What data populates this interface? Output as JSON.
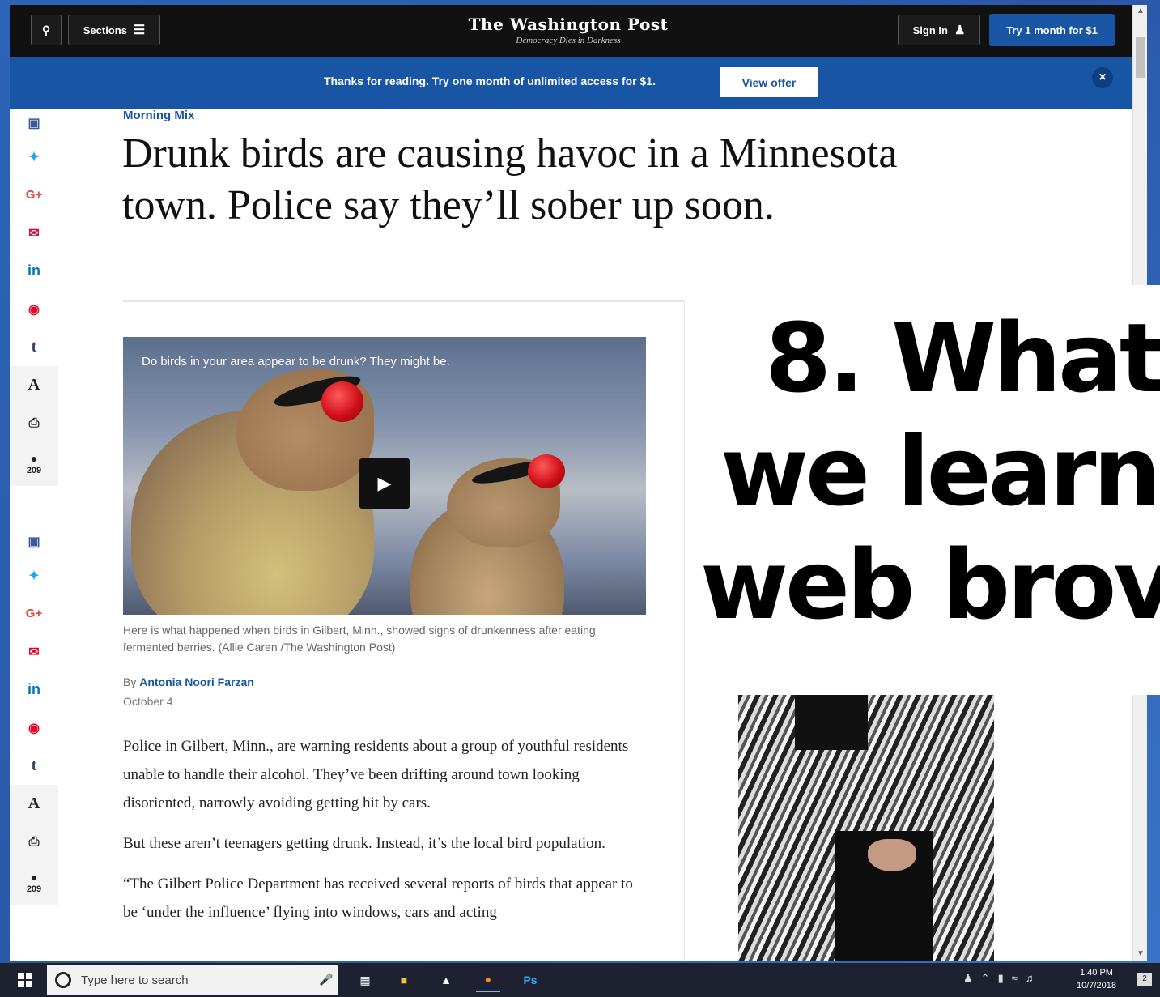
{
  "nav": {
    "sections_label": "Sections",
    "logo": "The Washington Post",
    "tagline": "Democracy Dies in Darkness",
    "signin_label": "Sign In",
    "try_label": "Try 1 month for $1"
  },
  "banner": {
    "text": "Thanks for reading. Try one month of unlimited access for $1.",
    "button": "View offer",
    "close": "×"
  },
  "share_rail": {
    "tools": {
      "font_label": "A",
      "comment_count": "209"
    }
  },
  "article": {
    "kicker": "Morning Mix",
    "headline": "Drunk birds are causing havoc in a Minnesota town. Police say they’ll sober up soon.",
    "video_title": "Do birds in your area appear to be drunk? They might be.",
    "video_caption": "Here is what happened when birds in Gilbert, Minn., showed signs of drunkenness after eating fermented berries. (Allie Caren /The Washington Post)",
    "byline_prefix": "By",
    "author": "Antonia Noori Farzan",
    "date": "October 4",
    "paragraphs": [
      "Police in Gilbert, Minn., are warning residents about a group of youthful residents unable to handle their alcohol. They’ve been drifting around town looking disoriented, narrowly avoiding getting hit by cars.",
      "But these aren’t teenagers getting drunk. Instead, it’s the local bird population.",
      "“The Gilbert Police Department has received several reports of birds that appear to be ‘under the influence’ flying into windows, cars and acting"
    ]
  },
  "overlay": {
    "line1": "8. What",
    "line2": "we learn",
    "line3": "web brov"
  },
  "taskbar": {
    "search_placeholder": "Type here to search",
    "time": "1:40 PM",
    "date": "10/7/2018",
    "notif_count": "2"
  }
}
